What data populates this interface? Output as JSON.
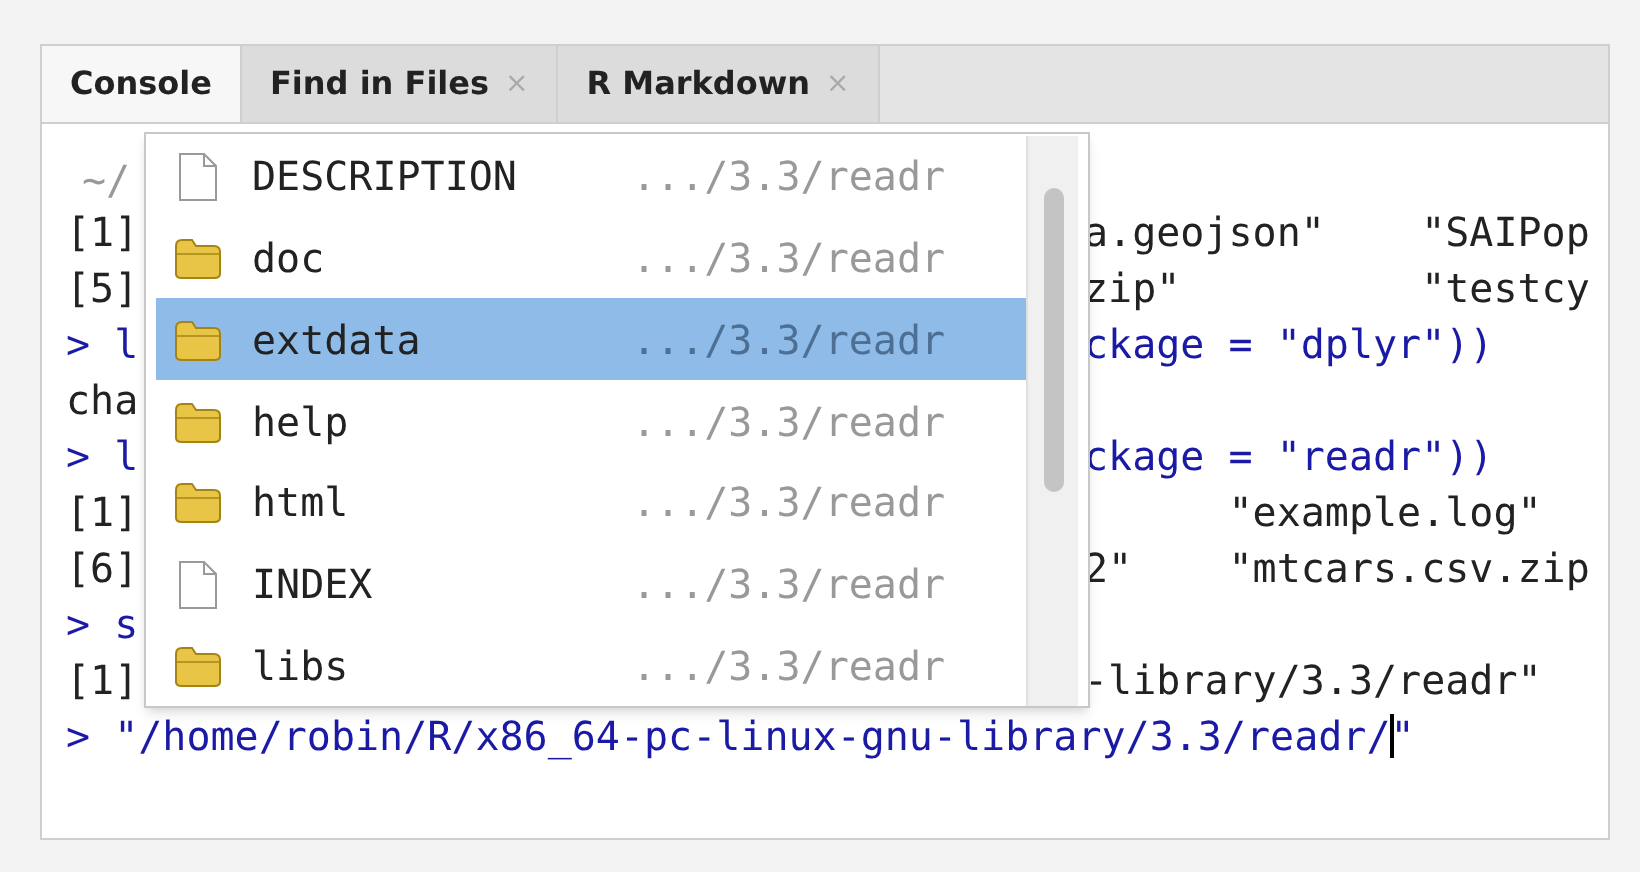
{
  "tabs": [
    {
      "label": "Console",
      "selected": true
    },
    {
      "label": "Find in Files",
      "selected": false,
      "close": "×"
    },
    {
      "label": "R Markdown",
      "selected": false,
      "close": "×"
    }
  ],
  "console": {
    "path": "~/",
    "lines": [
      {
        "kind": "output",
        "left": "[1]",
        "right": "a.geojson\"    \"SAIPop"
      },
      {
        "kind": "output",
        "left": "[5]",
        "right": "zip\"          \"testcy"
      },
      {
        "kind": "input",
        "left": "> l",
        "right": "ckage = \"dplyr\"))"
      },
      {
        "kind": "output",
        "left": "cha"
      },
      {
        "kind": "input",
        "left": "> l",
        "right": "ckage = \"readr\"))"
      },
      {
        "kind": "output",
        "left": "[1]",
        "right": "      \"example.log\""
      },
      {
        "kind": "output",
        "left": "[6]",
        "right": "2\"    \"mtcars.csv.zip"
      },
      {
        "kind": "input",
        "left": "> s"
      },
      {
        "kind": "output",
        "left": "[1]",
        "right": "-library/3.3/readr\""
      }
    ],
    "command": "> \"/home/robin/R/x86_64-pc-linux-gnu-library/3.3/readr/\""
  },
  "completions": [
    {
      "kind": "file",
      "name": "DESCRIPTION",
      "path": ".../3.3/readr",
      "selected": false
    },
    {
      "kind": "folder",
      "name": "doc",
      "path": ".../3.3/readr",
      "selected": false
    },
    {
      "kind": "folder",
      "name": "extdata",
      "path": ".../3.3/readr",
      "selected": true
    },
    {
      "kind": "folder",
      "name": "help",
      "path": ".../3.3/readr",
      "selected": false
    },
    {
      "kind": "folder",
      "name": "html",
      "path": ".../3.3/readr",
      "selected": false
    },
    {
      "kind": "file",
      "name": "INDEX",
      "path": ".../3.3/readr",
      "selected": false
    },
    {
      "kind": "folder",
      "name": "libs",
      "path": ".../3.3/readr",
      "selected": false
    }
  ]
}
